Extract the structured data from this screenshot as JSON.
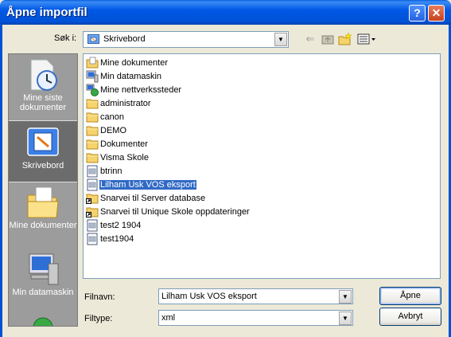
{
  "window": {
    "title": "Åpne importfil",
    "help": "?",
    "close": "✕"
  },
  "lookin": {
    "label": "Søk i:",
    "value": "Skrivebord",
    "icon": "desktop-icon"
  },
  "toolbar": {
    "icons": [
      "back-arrow-icon",
      "up-folder-icon",
      "new-folder-icon",
      "view-menu-icon"
    ]
  },
  "places": [
    {
      "label": "Mine siste dokumenter",
      "icon": "recent-documents-icon"
    },
    {
      "label": "Skrivebord",
      "icon": "desktop-icon"
    },
    {
      "label": "Mine dokumenter",
      "icon": "my-documents-icon"
    },
    {
      "label": "Min datamaskin",
      "icon": "my-computer-icon"
    }
  ],
  "files": [
    {
      "label": "Mine dokumenter",
      "icon": "my-documents-icon"
    },
    {
      "label": "Min datamaskin",
      "icon": "my-computer-icon"
    },
    {
      "label": "Mine nettverkssteder",
      "icon": "network-places-icon"
    },
    {
      "label": "administrator",
      "icon": "folder-icon"
    },
    {
      "label": "canon",
      "icon": "folder-icon"
    },
    {
      "label": "DEMO",
      "icon": "folder-icon"
    },
    {
      "label": "Dokumenter",
      "icon": "folder-icon"
    },
    {
      "label": "Visma Skole",
      "icon": "folder-icon"
    },
    {
      "label": "btrinn",
      "icon": "xml-file-icon"
    },
    {
      "label": "Lilham Usk VOS eksport",
      "icon": "xml-file-icon",
      "selected": true
    },
    {
      "label": "Snarvei til Server database",
      "icon": "shortcut-folder-icon"
    },
    {
      "label": "Snarvei til Unique Skole oppdateringer",
      "icon": "shortcut-folder-icon"
    },
    {
      "label": "test2 1904",
      "icon": "xml-file-icon"
    },
    {
      "label": "test1904",
      "icon": "xml-file-icon"
    }
  ],
  "filename": {
    "label": "Filnavn:",
    "value": "Lilham Usk VOS eksport"
  },
  "filetype": {
    "label": "Filtype:",
    "value": "xml"
  },
  "buttons": {
    "open": "Åpne",
    "cancel": "Avbryt"
  },
  "colors": {
    "titlebar": "#0058E6",
    "selection": "#316AC5",
    "dialog_bg": "#ECE9D8",
    "places_bg": "#9C9C9C"
  }
}
